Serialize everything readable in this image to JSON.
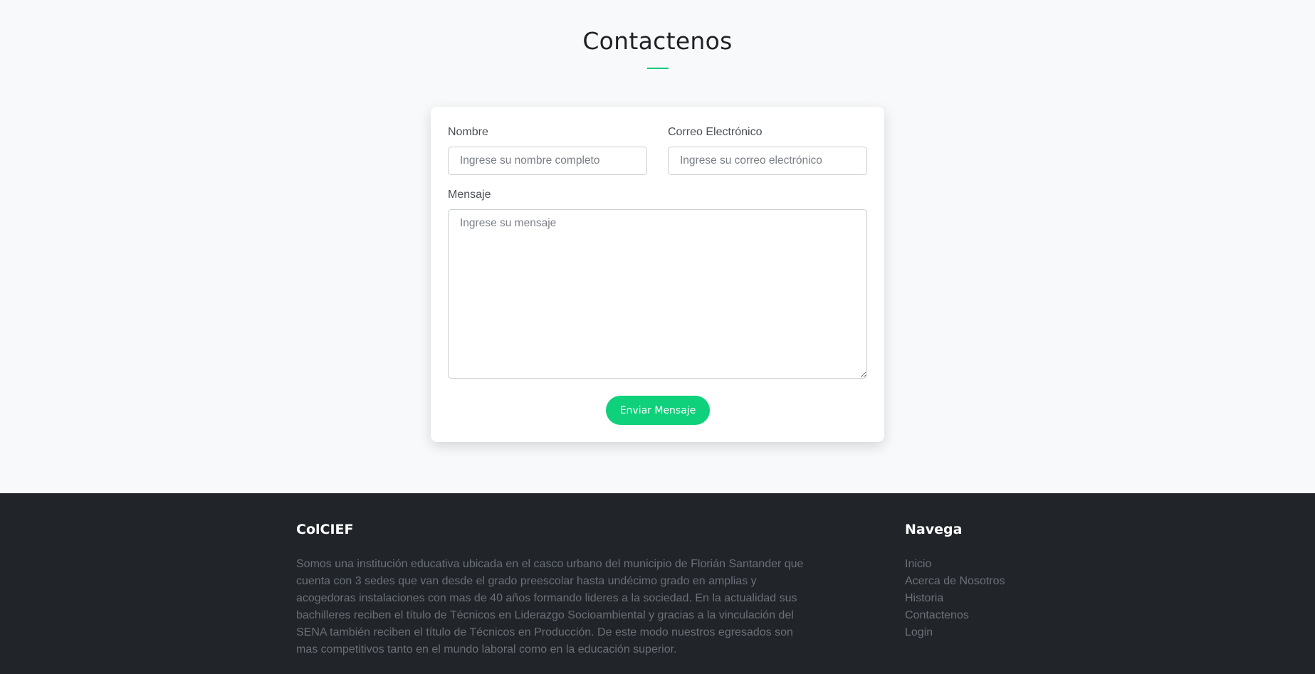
{
  "contact": {
    "title": "Contactenos",
    "accent_color": "#0fc97a",
    "form": {
      "name_label": "Nombre",
      "name_placeholder": "Ingrese su nombre completo",
      "email_label": "Correo Electrónico",
      "email_placeholder": "Ingrese su correo electrónico",
      "message_label": "Mensaje",
      "message_placeholder": "Ingrese su mensaje",
      "submit_label": "Enviar Mensaje"
    }
  },
  "footer": {
    "about_heading": "ColCIEF",
    "about_text": "Somos una institución educativa ubicada en el casco urbano del municipio de Florián Santander que cuenta con 3 sedes que van desde el grado preescolar hasta undécimo grado en amplias y acogedoras instalaciones con mas de 40 años formando lideres a la sociedad. En la actualidad sus bachilleres reciben el título de Técnicos en Liderazgo Socioambiental y gracias a la vinculación del SENA también reciben el título de Técnicos en Producción. De este modo nuestros egresados son mas competitivos tanto en el mundo laboral como en la educación superior.",
    "nav_heading": "Navega",
    "nav_links": [
      {
        "label": "Inicio"
      },
      {
        "label": "Acerca de Nosotros"
      },
      {
        "label": "Historia"
      },
      {
        "label": "Contactenos"
      },
      {
        "label": "Login"
      }
    ]
  }
}
